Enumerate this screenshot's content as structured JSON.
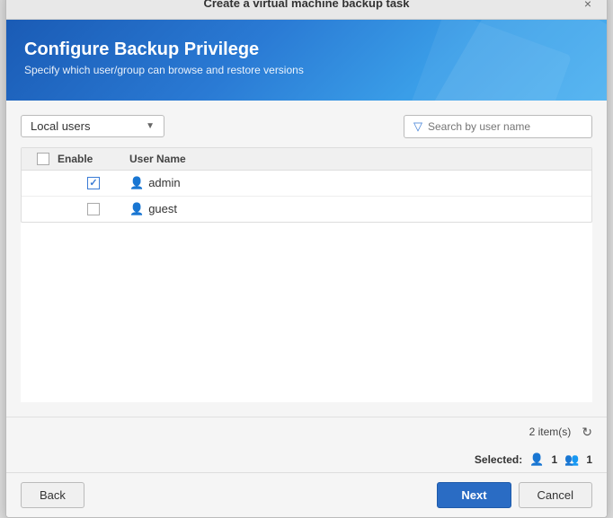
{
  "dialog": {
    "title": "Create a virtual machine backup task",
    "close_label": "×"
  },
  "header": {
    "title": "Configure Backup Privilege",
    "subtitle": "Specify which user/group can browse and restore versions"
  },
  "toolbar": {
    "user_type_label": "Local users",
    "search_placeholder": "Search by user name"
  },
  "table": {
    "col_enable": "Enable",
    "col_username": "User Name",
    "rows": [
      {
        "enabled": true,
        "username": "admin"
      },
      {
        "enabled": false,
        "username": "guest"
      }
    ]
  },
  "footer": {
    "item_count": "2 item(s)",
    "selected_label": "Selected:",
    "selected_user_count": "1",
    "selected_group_count": "1"
  },
  "buttons": {
    "back": "Back",
    "next": "Next",
    "cancel": "Cancel"
  }
}
